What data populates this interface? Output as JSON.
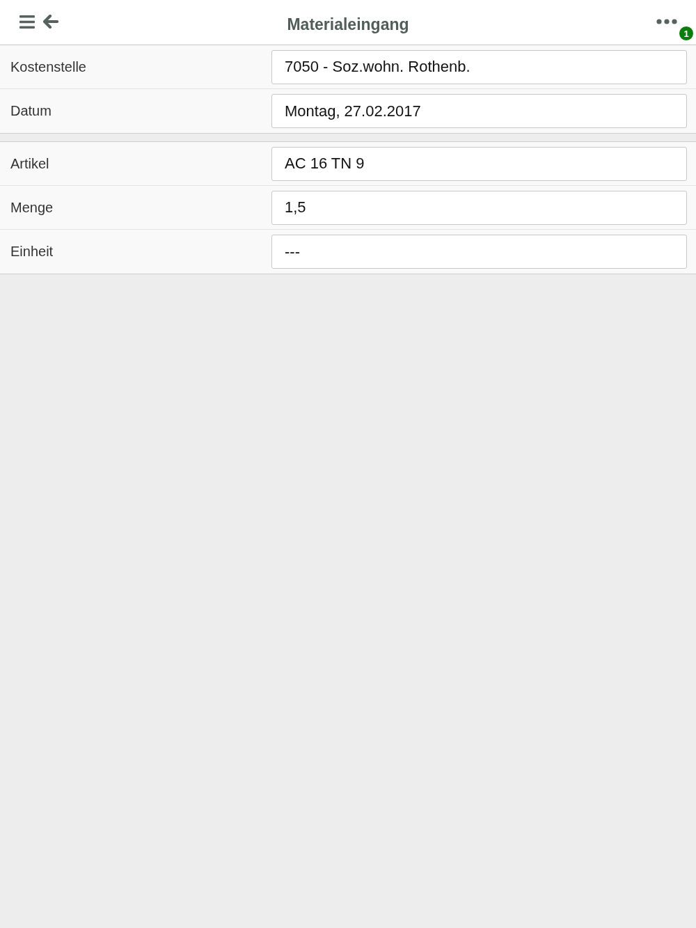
{
  "header": {
    "title": "Materialeingang",
    "badge": "1"
  },
  "sections": [
    {
      "rows": [
        {
          "label": "Kostenstelle",
          "value": "7050 - Soz.wohn. Rothenb."
        },
        {
          "label": "Datum",
          "value": "Montag, 27.02.2017"
        }
      ]
    },
    {
      "rows": [
        {
          "label": "Artikel",
          "value": "AC 16 TN 9"
        },
        {
          "label": "Menge",
          "value": "1,5"
        },
        {
          "label": "Einheit",
          "value": "---"
        }
      ]
    }
  ]
}
